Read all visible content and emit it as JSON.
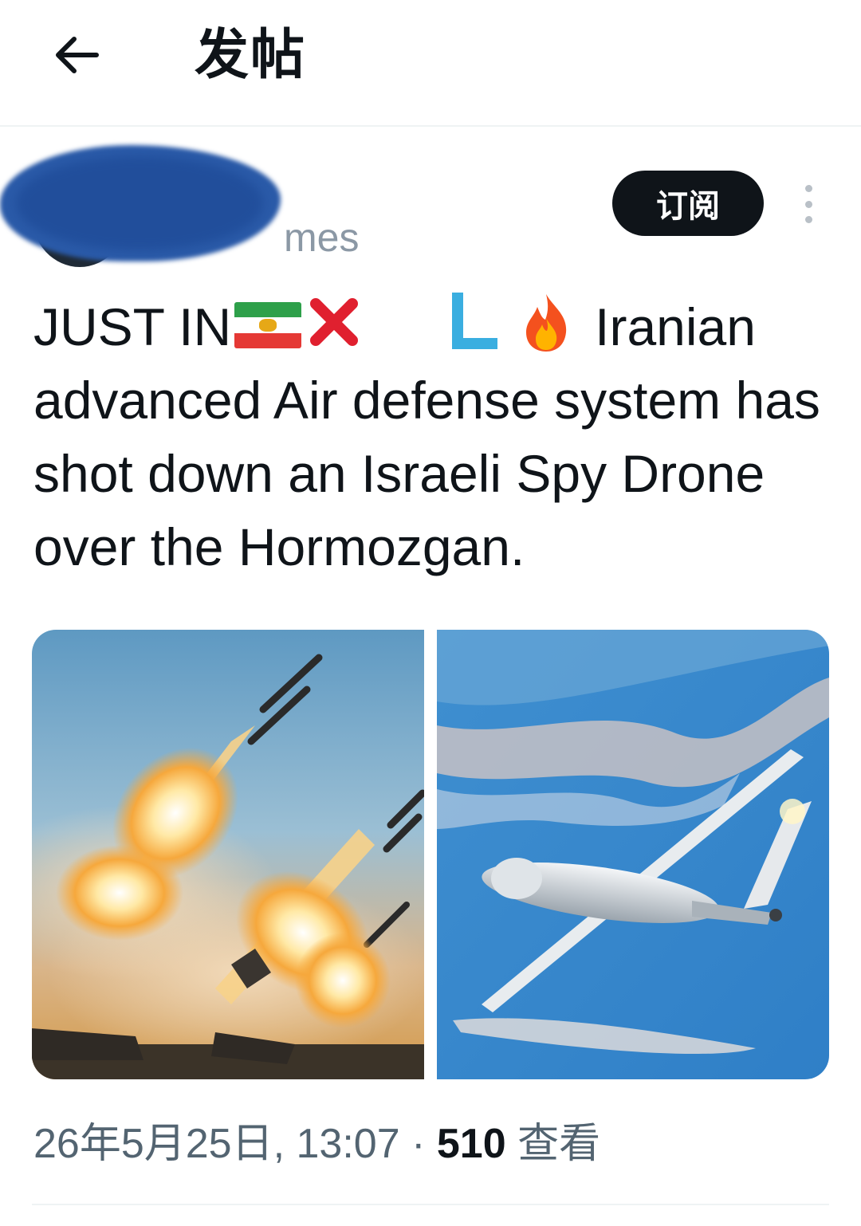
{
  "header": {
    "back_icon": "arrow-left-icon",
    "title": "发帖"
  },
  "author": {
    "handle_fragment": "mes",
    "subscribe_label": "订阅",
    "more_icon": "more-vertical-icon"
  },
  "post": {
    "prefix": "JUST IN",
    "emojis": [
      "iran-flag-emoji",
      "cross-mark-emoji",
      "letter-l-emoji",
      "fire-emoji"
    ],
    "after_emojis": "Iranian",
    "body": "advanced Air defense system has shot down an Israeli Spy Drone over the Hormozgan.",
    "media": [
      {
        "name": "rocket-launch-photo"
      },
      {
        "name": "drone-photo"
      }
    ]
  },
  "meta": {
    "date": "26年5月25日, 13:07",
    "separator": "·",
    "views_count": "510",
    "views_label": "查看"
  },
  "colors": {
    "text": "#0f1419",
    "secondary": "#536471",
    "button_bg": "#0f1419"
  }
}
